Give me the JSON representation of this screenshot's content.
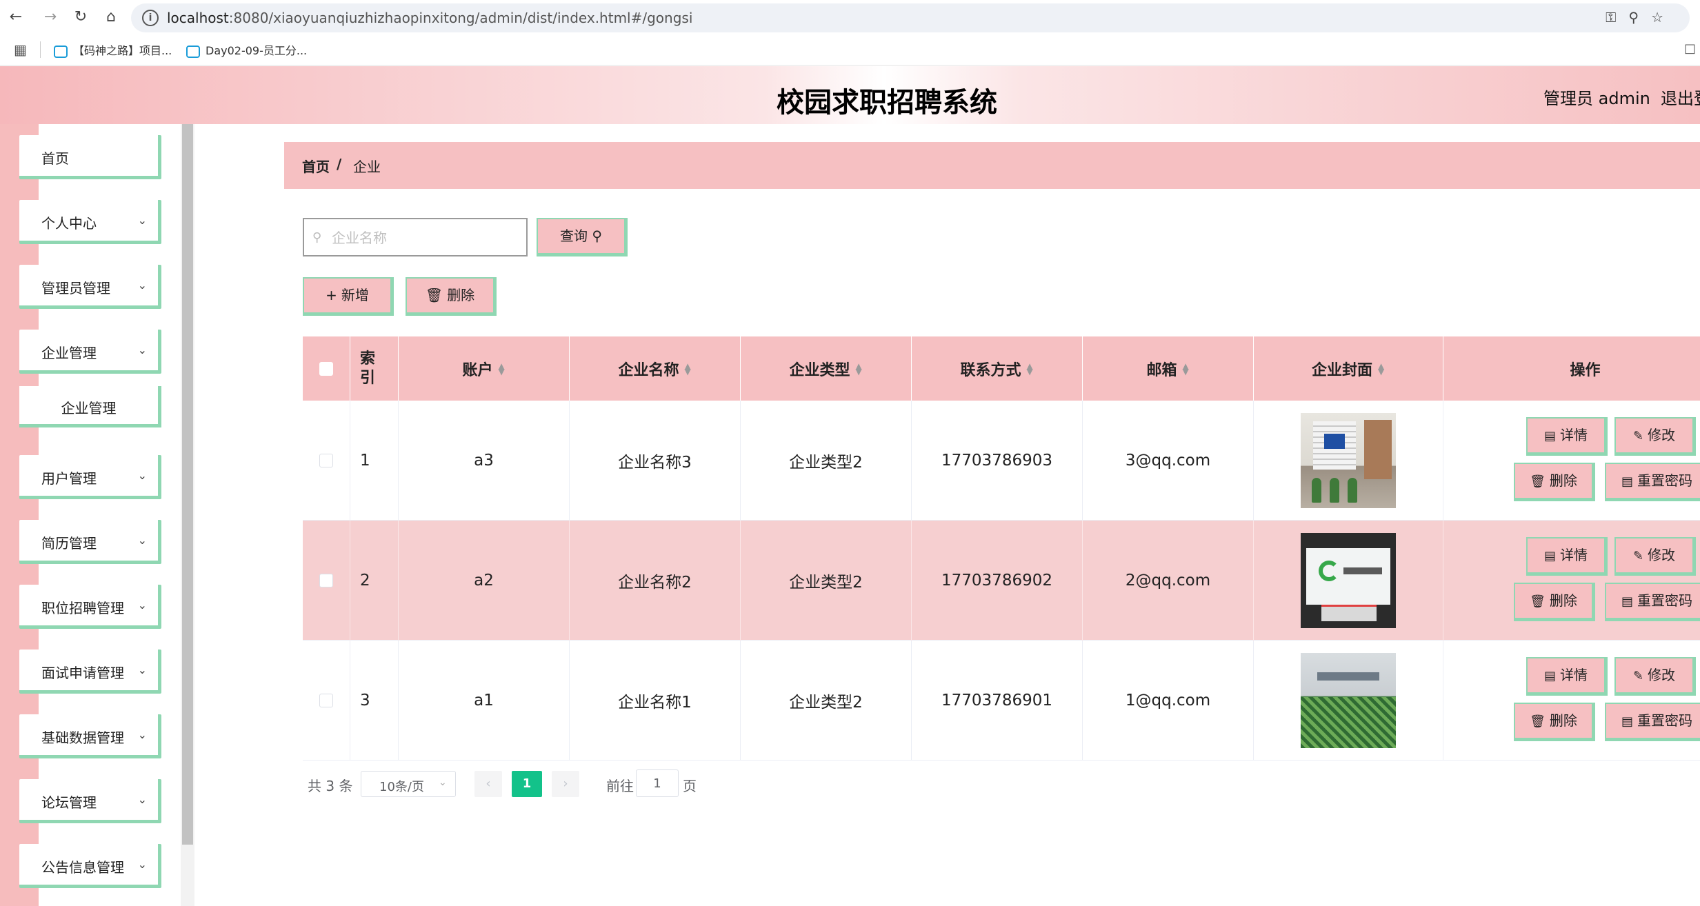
{
  "browser": {
    "url_host": "localhost",
    "url_path": ":8080/xiaoyuanqiuzhizhaopinxitong/admin/dist/index.html#/gongsi",
    "bookmarks": [
      "【码神之路】项目...",
      "Day02-09-员工分..."
    ]
  },
  "header": {
    "title": "校园求职招聘系统",
    "admin_label": "管理员 admin",
    "logout_label": "退出登"
  },
  "sidebar": {
    "items": [
      {
        "label": "首页"
      },
      {
        "label": "个人中心"
      },
      {
        "label": "管理员管理"
      },
      {
        "label": "企业管理"
      },
      {
        "label": "企业管理",
        "sub": true
      },
      {
        "label": "用户管理"
      },
      {
        "label": "简历管理"
      },
      {
        "label": "职位招聘管理"
      },
      {
        "label": "面试申请管理"
      },
      {
        "label": "基础数据管理"
      },
      {
        "label": "论坛管理"
      },
      {
        "label": "公告信息管理"
      }
    ]
  },
  "breadcrumb": {
    "home": "首页",
    "separator": "/",
    "current": "企业"
  },
  "search": {
    "placeholder": "企业名称",
    "value": "",
    "query_label": "查询"
  },
  "toolbar": {
    "add_label": "新增",
    "delete_label": "删除"
  },
  "table": {
    "headers": [
      "索引",
      "账户",
      "企业名称",
      "企业类型",
      "联系方式",
      "邮箱",
      "企业封面",
      "操作"
    ],
    "rows": [
      {
        "index": "1",
        "account": "a3",
        "name": "企业名称3",
        "type": "企业类型2",
        "phone": "17703786903",
        "email": "3@qq.com"
      },
      {
        "index": "2",
        "account": "a2",
        "name": "企业名称2",
        "type": "企业类型2",
        "phone": "17703786902",
        "email": "2@qq.com"
      },
      {
        "index": "3",
        "account": "a1",
        "name": "企业名称1",
        "type": "企业类型2",
        "phone": "17703786901",
        "email": "1@qq.com"
      }
    ],
    "actions": {
      "detail": "详情",
      "edit": "修改",
      "delete": "删除",
      "reset_password": "重置密码"
    }
  },
  "pagination": {
    "total_text": "共 3 条",
    "page_size": "10条/页",
    "current_page": "1",
    "goto_label": "前往",
    "goto_value": "1",
    "page_unit": "页"
  },
  "colors": {
    "accent_pink": "#f6c0c2",
    "accent_green": "#8fd7b2",
    "current_page": "#13c28a"
  }
}
